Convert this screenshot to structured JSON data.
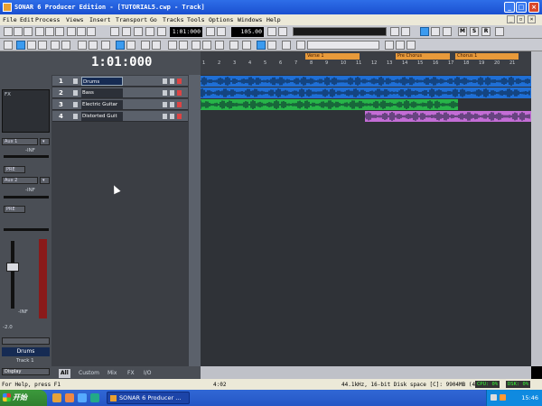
{
  "window": {
    "title": "SONAR 6 Producer Edition - [TUTORIAL5.cwp - Track]",
    "controls": {
      "minimize": "_",
      "maximize": "□",
      "close": "×"
    }
  },
  "menu": {
    "items": [
      "File",
      "Edit",
      "Process",
      "Views",
      "Insert",
      "Transport",
      "Go",
      "Tracks",
      "Tools",
      "Options",
      "Windows",
      "Help"
    ]
  },
  "toolbar": {
    "now_time": "1:01:000",
    "tempo": "105.00",
    "msr_labels": [
      "M",
      "S",
      "R"
    ]
  },
  "time_display": "1:01:000",
  "ruler": {
    "measures": [
      "1",
      "2",
      "3",
      "4",
      "5",
      "6",
      "7",
      "8",
      "9",
      "10",
      "11",
      "12",
      "13",
      "14",
      "15",
      "16",
      "17",
      "18",
      "19",
      "20",
      "21"
    ],
    "markers": [
      "Verse 1",
      "Pre Chorus",
      "Chorus 1"
    ]
  },
  "tracks": [
    {
      "num": "1",
      "name": "Drums",
      "color": "#1f6fd6"
    },
    {
      "num": "2",
      "name": "Bass",
      "color": "#1f6fd6"
    },
    {
      "num": "3",
      "name": "Electric Guitar",
      "color": "#27b449"
    },
    {
      "num": "4",
      "name": "Distorted Guit",
      "color": "#c46dd6"
    }
  ],
  "inspector": {
    "fx_label": "FX",
    "aux1": "Aux 1",
    "aux2": "Aux 2",
    "db1": "-INF",
    "db2": "-INF",
    "pre1": "PRE",
    "pre2": "PRE",
    "volume_db": "-INF",
    "vol_readout": "-2.0",
    "track_label": "Drums",
    "track_sub": "Track 1",
    "display_label": "Display"
  },
  "tabs": [
    "All",
    "Custom",
    "Mix",
    "FX",
    "I/O"
  ],
  "status": {
    "help": "For Help, press F1",
    "position": "4:02",
    "audio_info": "44.1kHz, 16-bit Disk space [C]: 9904MB (49",
    "cpu": "CPU: 0%",
    "disk": "DSK: 0%"
  },
  "taskbar": {
    "start": "开始",
    "task": "SONAR 6 Producer ...",
    "clock": "15:46"
  }
}
